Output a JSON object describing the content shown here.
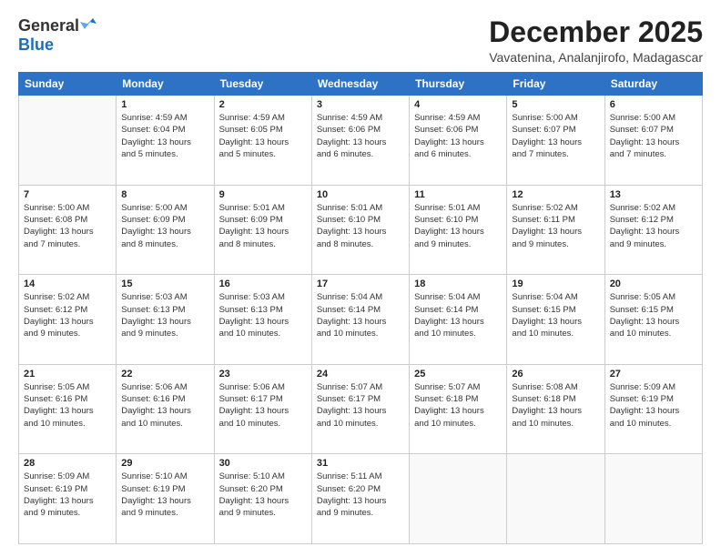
{
  "header": {
    "logo_general": "General",
    "logo_blue": "Blue",
    "month_title": "December 2025",
    "location": "Vavatenina, Analanjirofo, Madagascar"
  },
  "days_of_week": [
    "Sunday",
    "Monday",
    "Tuesday",
    "Wednesday",
    "Thursday",
    "Friday",
    "Saturday"
  ],
  "weeks": [
    [
      {
        "day": "",
        "info": ""
      },
      {
        "day": "1",
        "info": "Sunrise: 4:59 AM\nSunset: 6:04 PM\nDaylight: 13 hours\nand 5 minutes."
      },
      {
        "day": "2",
        "info": "Sunrise: 4:59 AM\nSunset: 6:05 PM\nDaylight: 13 hours\nand 5 minutes."
      },
      {
        "day": "3",
        "info": "Sunrise: 4:59 AM\nSunset: 6:06 PM\nDaylight: 13 hours\nand 6 minutes."
      },
      {
        "day": "4",
        "info": "Sunrise: 4:59 AM\nSunset: 6:06 PM\nDaylight: 13 hours\nand 6 minutes."
      },
      {
        "day": "5",
        "info": "Sunrise: 5:00 AM\nSunset: 6:07 PM\nDaylight: 13 hours\nand 7 minutes."
      },
      {
        "day": "6",
        "info": "Sunrise: 5:00 AM\nSunset: 6:07 PM\nDaylight: 13 hours\nand 7 minutes."
      }
    ],
    [
      {
        "day": "7",
        "info": "Sunrise: 5:00 AM\nSunset: 6:08 PM\nDaylight: 13 hours\nand 7 minutes."
      },
      {
        "day": "8",
        "info": "Sunrise: 5:00 AM\nSunset: 6:09 PM\nDaylight: 13 hours\nand 8 minutes."
      },
      {
        "day": "9",
        "info": "Sunrise: 5:01 AM\nSunset: 6:09 PM\nDaylight: 13 hours\nand 8 minutes."
      },
      {
        "day": "10",
        "info": "Sunrise: 5:01 AM\nSunset: 6:10 PM\nDaylight: 13 hours\nand 8 minutes."
      },
      {
        "day": "11",
        "info": "Sunrise: 5:01 AM\nSunset: 6:10 PM\nDaylight: 13 hours\nand 9 minutes."
      },
      {
        "day": "12",
        "info": "Sunrise: 5:02 AM\nSunset: 6:11 PM\nDaylight: 13 hours\nand 9 minutes."
      },
      {
        "day": "13",
        "info": "Sunrise: 5:02 AM\nSunset: 6:12 PM\nDaylight: 13 hours\nand 9 minutes."
      }
    ],
    [
      {
        "day": "14",
        "info": "Sunrise: 5:02 AM\nSunset: 6:12 PM\nDaylight: 13 hours\nand 9 minutes."
      },
      {
        "day": "15",
        "info": "Sunrise: 5:03 AM\nSunset: 6:13 PM\nDaylight: 13 hours\nand 9 minutes."
      },
      {
        "day": "16",
        "info": "Sunrise: 5:03 AM\nSunset: 6:13 PM\nDaylight: 13 hours\nand 10 minutes."
      },
      {
        "day": "17",
        "info": "Sunrise: 5:04 AM\nSunset: 6:14 PM\nDaylight: 13 hours\nand 10 minutes."
      },
      {
        "day": "18",
        "info": "Sunrise: 5:04 AM\nSunset: 6:14 PM\nDaylight: 13 hours\nand 10 minutes."
      },
      {
        "day": "19",
        "info": "Sunrise: 5:04 AM\nSunset: 6:15 PM\nDaylight: 13 hours\nand 10 minutes."
      },
      {
        "day": "20",
        "info": "Sunrise: 5:05 AM\nSunset: 6:15 PM\nDaylight: 13 hours\nand 10 minutes."
      }
    ],
    [
      {
        "day": "21",
        "info": "Sunrise: 5:05 AM\nSunset: 6:16 PM\nDaylight: 13 hours\nand 10 minutes."
      },
      {
        "day": "22",
        "info": "Sunrise: 5:06 AM\nSunset: 6:16 PM\nDaylight: 13 hours\nand 10 minutes."
      },
      {
        "day": "23",
        "info": "Sunrise: 5:06 AM\nSunset: 6:17 PM\nDaylight: 13 hours\nand 10 minutes."
      },
      {
        "day": "24",
        "info": "Sunrise: 5:07 AM\nSunset: 6:17 PM\nDaylight: 13 hours\nand 10 minutes."
      },
      {
        "day": "25",
        "info": "Sunrise: 5:07 AM\nSunset: 6:18 PM\nDaylight: 13 hours\nand 10 minutes."
      },
      {
        "day": "26",
        "info": "Sunrise: 5:08 AM\nSunset: 6:18 PM\nDaylight: 13 hours\nand 10 minutes."
      },
      {
        "day": "27",
        "info": "Sunrise: 5:09 AM\nSunset: 6:19 PM\nDaylight: 13 hours\nand 10 minutes."
      }
    ],
    [
      {
        "day": "28",
        "info": "Sunrise: 5:09 AM\nSunset: 6:19 PM\nDaylight: 13 hours\nand 9 minutes."
      },
      {
        "day": "29",
        "info": "Sunrise: 5:10 AM\nSunset: 6:19 PM\nDaylight: 13 hours\nand 9 minutes."
      },
      {
        "day": "30",
        "info": "Sunrise: 5:10 AM\nSunset: 6:20 PM\nDaylight: 13 hours\nand 9 minutes."
      },
      {
        "day": "31",
        "info": "Sunrise: 5:11 AM\nSunset: 6:20 PM\nDaylight: 13 hours\nand 9 minutes."
      },
      {
        "day": "",
        "info": ""
      },
      {
        "day": "",
        "info": ""
      },
      {
        "day": "",
        "info": ""
      }
    ]
  ]
}
